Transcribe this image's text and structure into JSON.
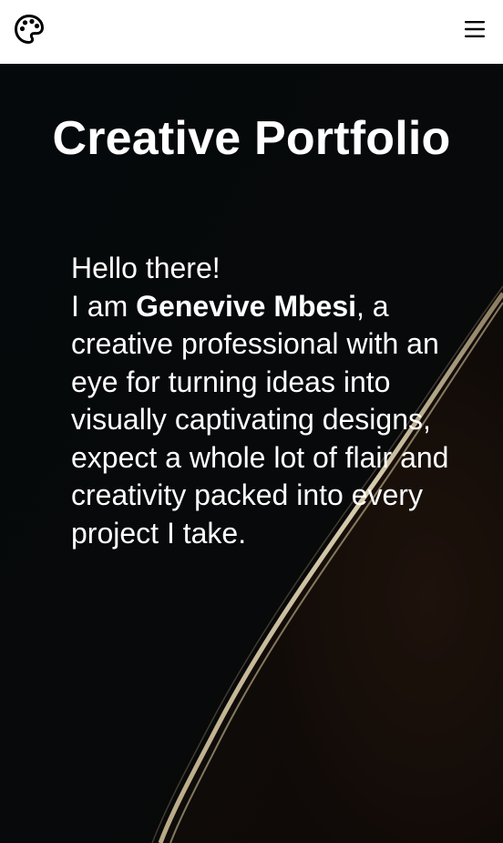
{
  "navbar": {
    "logo_icon": "palette-icon",
    "menu_icon": "hamburger-menu-icon"
  },
  "hero": {
    "title": "Creative Portfolio",
    "greeting": "Hello there!",
    "intro_prefix": "I am ",
    "name": "Genevive Mbesi",
    "intro_suffix": ", a creative professional with an eye for turning ideas into visually captivating designs, expect a whole lot of flair and creativity packed into every project I take."
  },
  "colors": {
    "nav_background": "#ffffff",
    "hero_background": "#050708",
    "text": "#ffffff",
    "accent_curve": "#d9cfb4"
  }
}
